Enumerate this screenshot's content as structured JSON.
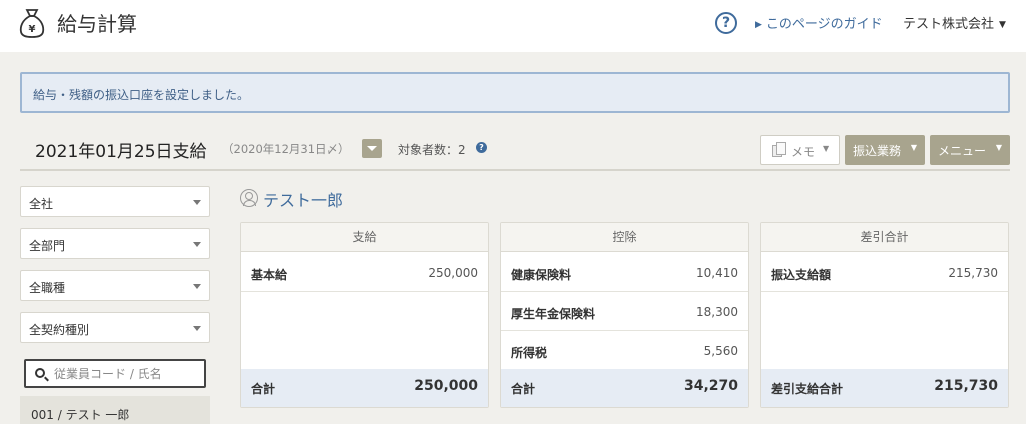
{
  "header": {
    "app_icon": "money-bag-yen-icon",
    "title": "給与計算",
    "help_icon": "question-circle-icon",
    "help_icon_glyph": "?",
    "guide_link": "このページのガイド",
    "company": "テスト株式会社"
  },
  "notice": {
    "message": "給与・残額の振込口座を設定しました。"
  },
  "pay_header": {
    "title": "2021年01月25日支給",
    "subtitle": "（2020年12月31日〆）",
    "target_count": "対象者数：2",
    "info_icon_glyph": "?"
  },
  "toolbar": {
    "memo_label": "メモ",
    "transfer_label": "振込業務",
    "menu_label": "メニュー"
  },
  "filters": {
    "company": "全社",
    "department": "全部門",
    "job_type": "全職種",
    "contract_type": "全契約種別"
  },
  "search": {
    "placeholder": "従業員コード / 氏名",
    "value": ""
  },
  "employee_list": {
    "items": [
      "001 / テスト 一郎"
    ]
  },
  "employee": {
    "name": "テスト一郎"
  },
  "panels": {
    "payment": {
      "title": "支給",
      "rows": [
        {
          "label": "基本給",
          "value": "250,000"
        }
      ],
      "total_label": "合計",
      "total_value": "250,000"
    },
    "deduction": {
      "title": "控除",
      "rows": [
        {
          "label": "健康保険料",
          "value": "10,410"
        },
        {
          "label": "厚生年金保険料",
          "value": "18,300"
        },
        {
          "label": "所得税",
          "value": "5,560"
        }
      ],
      "total_label": "合計",
      "total_value": "34,270"
    },
    "net": {
      "title": "差引合計",
      "rows": [
        {
          "label": "振込支給額",
          "value": "215,730"
        }
      ],
      "total_label": "差引支給合計",
      "total_value": "215,730"
    }
  },
  "colors": {
    "accent_blue": "#3f6b9c",
    "olive_button": "#a8a48e",
    "notice_bg": "#e6ecf4",
    "page_bg": "#f1f0ec"
  }
}
